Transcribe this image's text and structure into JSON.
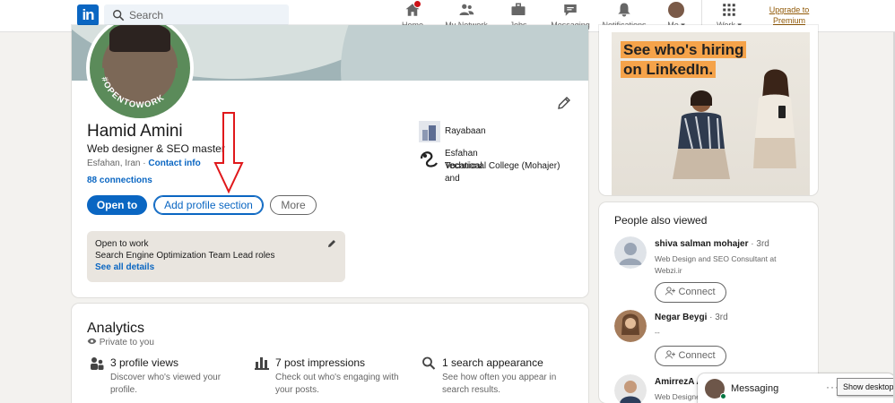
{
  "nav": {
    "logo": "in",
    "search_placeholder": "Search",
    "items": [
      {
        "label": "Home",
        "icon": "home-icon"
      },
      {
        "label": "My Network",
        "icon": "network-icon"
      },
      {
        "label": "Jobs",
        "icon": "briefcase-icon"
      },
      {
        "label": "Messaging",
        "icon": "messaging-icon"
      },
      {
        "label": "Notifications",
        "icon": "bell-icon"
      },
      {
        "label": "Me ▾",
        "icon": "avatar"
      },
      {
        "label": "Work ▾",
        "icon": "grid-icon"
      }
    ],
    "premium_line1": "Upgrade to",
    "premium_line2": "Premium"
  },
  "profile": {
    "avatar_ring_text": "#OPENTOWORK",
    "name": "Hamid Amini",
    "headline": "Web designer & SEO master",
    "location": "Esfahan, Iran",
    "location_sep": " · ",
    "contact_info": "Contact info",
    "connections": "88 connections",
    "buttons": {
      "open_to": "Open to",
      "add_section": "Add profile section",
      "more": "More"
    },
    "open_to_work": {
      "title": "Open to work",
      "description": "Search Engine Optimization Team Lead roles",
      "see_all": "See all details"
    },
    "experience_org": "Rayabaan",
    "education_org_line1": "Esfahan Technical and",
    "education_org_line2": "Vocational College (Mohajer)"
  },
  "analytics": {
    "title": "Analytics",
    "privacy": "Private to you",
    "stats": [
      {
        "headline": "3 profile views",
        "line1": "Discover who's viewed your",
        "line2": "profile."
      },
      {
        "headline": "7 post impressions",
        "line1": "Check out who's engaging with",
        "line2": "your posts."
      },
      {
        "headline": "1 search appearance",
        "line1": "See how often you appear in",
        "line2": "search results."
      }
    ]
  },
  "ad": {
    "line1": "See who's hiring",
    "line2": "on LinkedIn."
  },
  "people_also_viewed": {
    "title": "People also viewed",
    "connect_label": "Connect",
    "people": [
      {
        "name": "shiva salman mohajer",
        "degree": " · 3rd",
        "line1": "Web Design and SEO Consultant at",
        "line2": "Webzi.ir"
      },
      {
        "name": "Negar Beygi",
        "degree": " · 3rd",
        "line1": "--",
        "line2": ""
      },
      {
        "name": "AmirrezA A",
        "degree": "",
        "line1": "Web Designe",
        "line2": ""
      }
    ]
  },
  "messaging": {
    "label": "Messaging",
    "more": "···"
  },
  "tooltip": "Show desktop",
  "colors": {
    "brand_blue": "#0a66c2",
    "open_to_work_green": "#5b8b5a",
    "premium_gold": "#915907",
    "arrow_red": "#e0181b"
  }
}
